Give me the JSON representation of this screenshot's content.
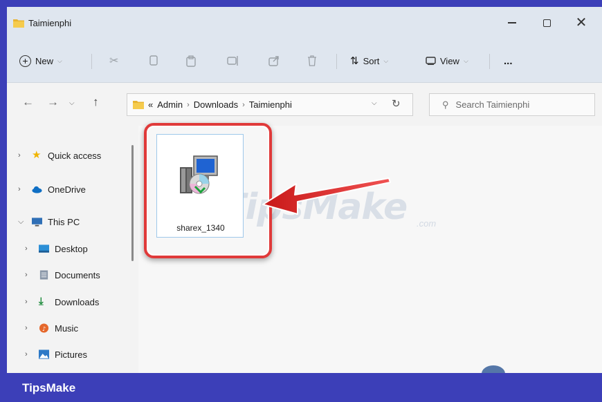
{
  "window": {
    "title": "Taimienphi"
  },
  "commandbar": {
    "new_label": "New",
    "sort_label": "Sort",
    "view_label": "View",
    "more_label": "..."
  },
  "address": {
    "overflow": "«",
    "crumbs": [
      "Admin",
      "Downloads",
      "Taimienphi"
    ]
  },
  "search": {
    "placeholder": "Search Taimienphi"
  },
  "sidebar": {
    "items": [
      {
        "label": "Quick access",
        "icon": "star-icon"
      },
      {
        "label": "OneDrive",
        "icon": "cloud-icon"
      },
      {
        "label": "This PC",
        "icon": "monitor-icon"
      },
      {
        "label": "Desktop",
        "icon": "desktop-icon"
      },
      {
        "label": "Documents",
        "icon": "documents-icon"
      },
      {
        "label": "Downloads",
        "icon": "download-icon"
      },
      {
        "label": "Music",
        "icon": "music-icon"
      },
      {
        "label": "Pictures",
        "icon": "pictures-icon"
      }
    ]
  },
  "files": [
    {
      "name": "sharex_1340",
      "icon": "installer-icon",
      "selected": true
    }
  ],
  "watermark": {
    "text": "TipsMake",
    "suffix": ".com"
  },
  "footer": {
    "brand": "TipsMake"
  },
  "colors": {
    "accent": "#3c3fb8",
    "highlight": "#e03a3a",
    "titlebar": "#dfe6ef"
  }
}
